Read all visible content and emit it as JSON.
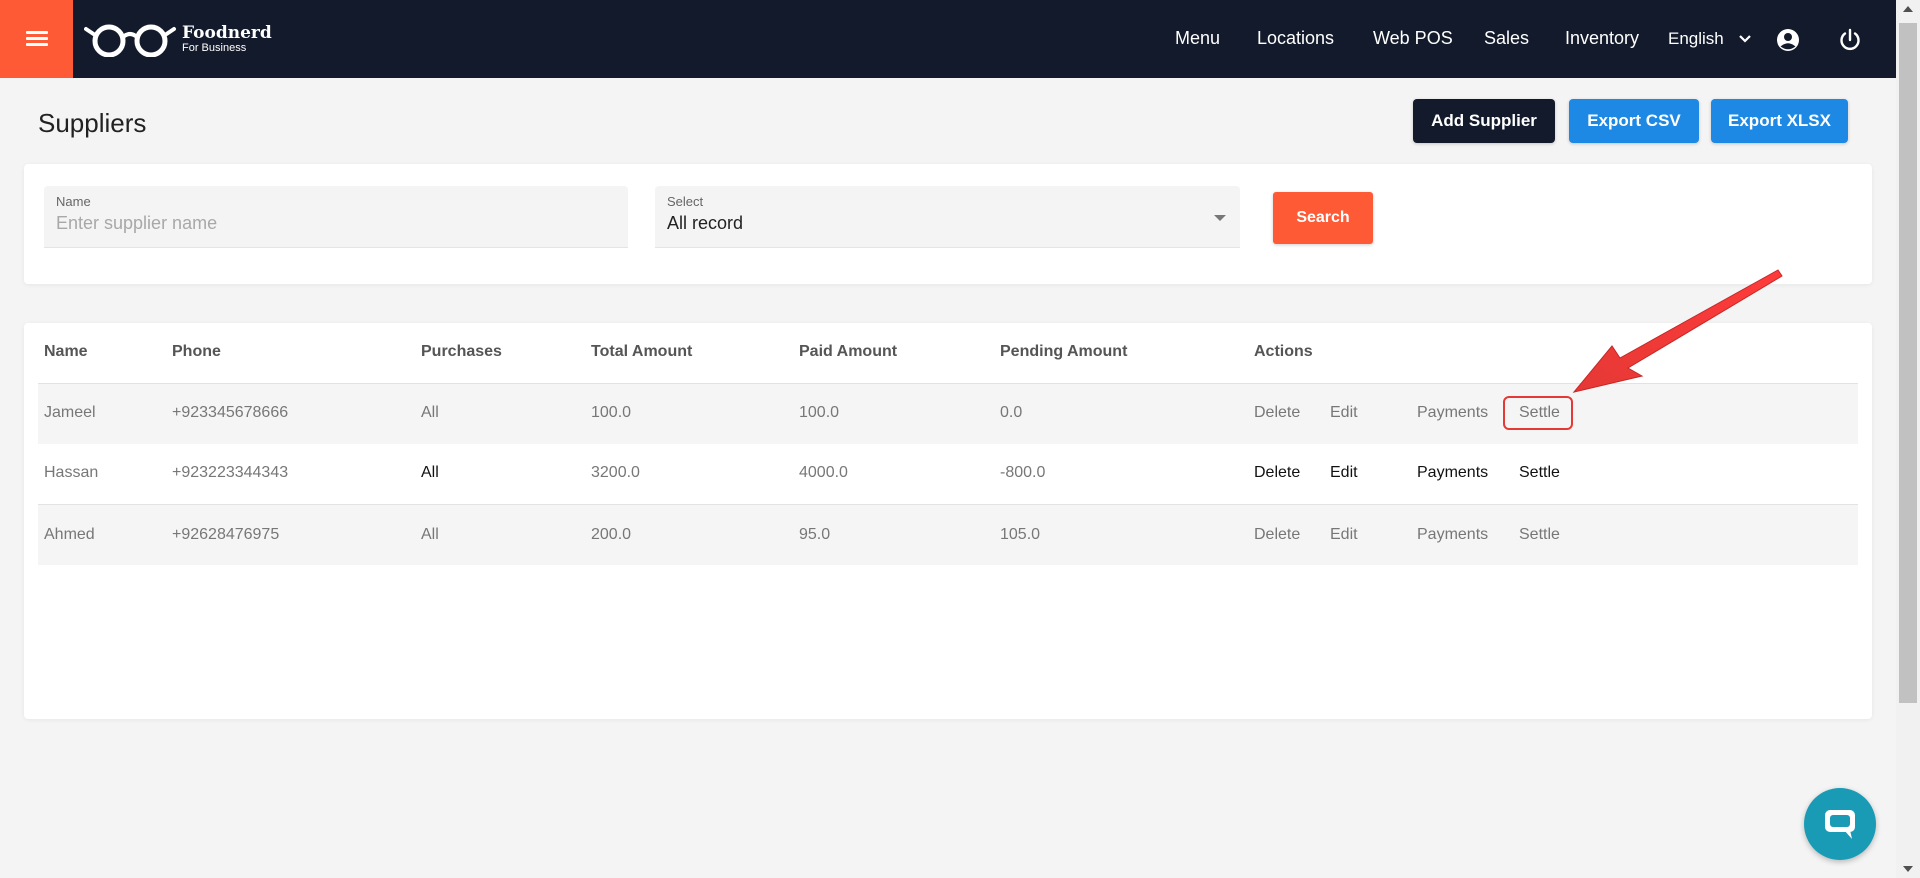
{
  "header": {
    "logo": {
      "brand": "Foodnerd",
      "sub": "For Business"
    },
    "nav": [
      "Menu",
      "Locations",
      "Web POS",
      "Sales",
      "Inventory"
    ],
    "language": "English"
  },
  "page": {
    "title": "Suppliers",
    "buttons": {
      "add": "Add Supplier",
      "csv": "Export CSV",
      "xlsx": "Export XLSX"
    }
  },
  "filters": {
    "name_label": "Name",
    "name_placeholder": "Enter supplier name",
    "select_label": "Select",
    "select_value": "All record",
    "search_label": "Search"
  },
  "table": {
    "columns": [
      "Name",
      "Phone",
      "Purchases",
      "Total Amount",
      "Paid Amount",
      "Pending Amount",
      "Actions"
    ],
    "rows": [
      {
        "name": "Jameel",
        "phone": "+923345678666",
        "purchases": "All",
        "total": "100.0",
        "paid": "100.0",
        "pending": "0.0",
        "actions": [
          "Delete",
          "Edit",
          "Payments",
          "Settle"
        ]
      },
      {
        "name": "Hassan",
        "phone": "+923223344343",
        "purchases": "All",
        "total": "3200.0",
        "paid": "4000.0",
        "pending": "-800.0",
        "actions": [
          "Delete",
          "Edit",
          "Payments",
          "Settle"
        ]
      },
      {
        "name": "Ahmed",
        "phone": "+92628476975",
        "purchases": "All",
        "total": "200.0",
        "paid": "95.0",
        "pending": "105.0",
        "actions": [
          "Delete",
          "Edit",
          "Payments",
          "Settle"
        ]
      }
    ]
  },
  "colors": {
    "navbar": "#131a2b",
    "accent": "#ff5a36",
    "export": "#1e88e5",
    "highlight": "#e53935",
    "chat": "#1a9bb5"
  },
  "icons": [
    "hamburger-icon",
    "glasses-logo-icon",
    "chevron-down-icon",
    "account-circle-icon",
    "power-icon",
    "chat-icon"
  ]
}
